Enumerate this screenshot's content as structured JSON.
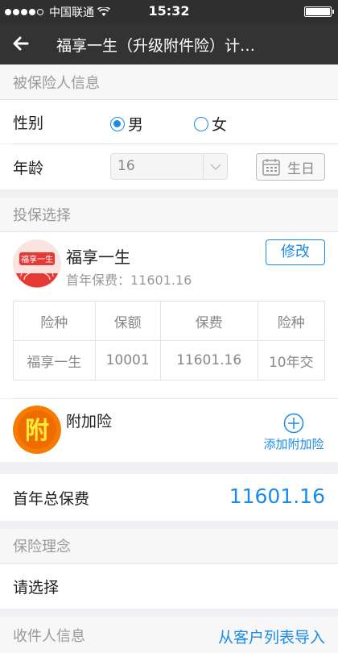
{
  "status_bar": {
    "carrier": "中国联通",
    "time": "15:32"
  },
  "nav": {
    "title": "福享一生（升级附件险）计…"
  },
  "insured": {
    "section_title": "被保险人信息",
    "gender_label": "性别",
    "gender_options": [
      {
        "label": "男",
        "selected": true
      },
      {
        "label": "女",
        "selected": false
      }
    ],
    "age_label": "年龄",
    "age_value": "16",
    "birthday_button": "生日"
  },
  "plan": {
    "section_title": "投保选择",
    "product_name": "福享一生",
    "logo_text": "福享一生",
    "first_year_premium_text": "首年保费：11601.16",
    "edit_button": "修改",
    "table_headers": [
      "险种",
      "保额",
      "保费",
      "险种"
    ],
    "table_rows": [
      [
        "福享一生",
        "10001",
        "11601.16",
        "10年交"
      ]
    ],
    "addon_logo_text": "附",
    "addon_title": "附加险",
    "addon_add_label": "添加附加险"
  },
  "total": {
    "label": "首年总保费",
    "value": "11601.16"
  },
  "philosophy": {
    "section_title": "保险理念",
    "placeholder": "请选择"
  },
  "recipient": {
    "section_title": "收件人信息",
    "import_link": "从客户列表导入"
  },
  "colors": {
    "accent": "#1a8be8",
    "navbar": "#333333",
    "logo_red": "#e53935",
    "addon_orange": "#f57c00"
  }
}
